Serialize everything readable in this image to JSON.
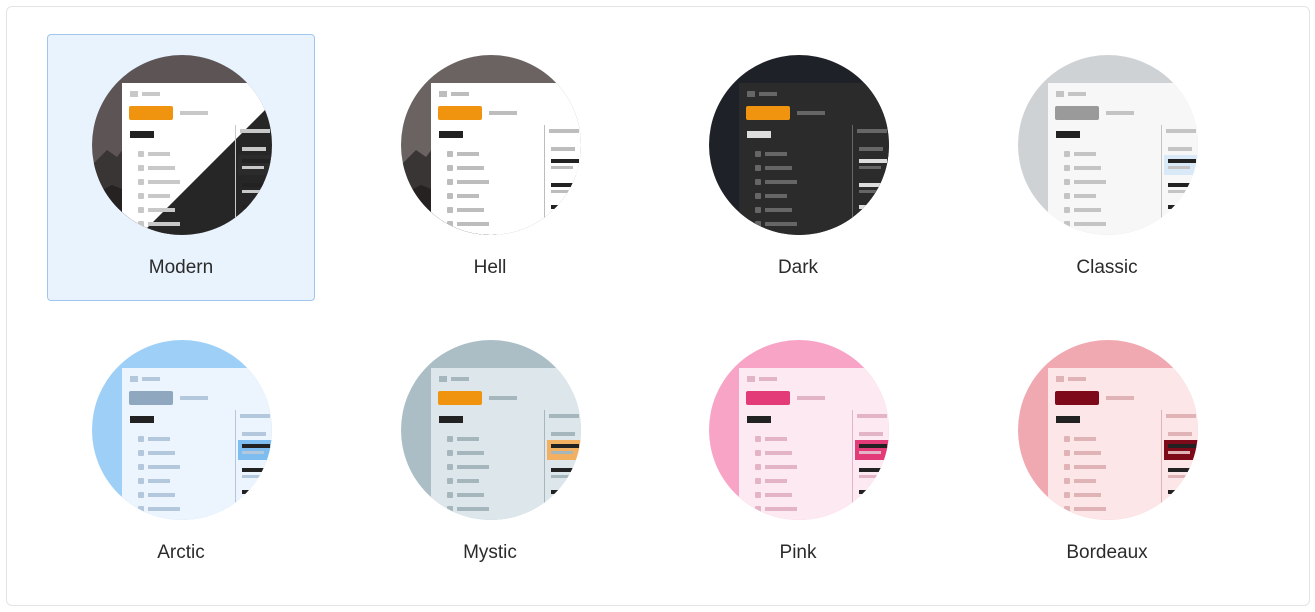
{
  "selected": "Modern",
  "themes": [
    {
      "label": "Modern",
      "bg": "#5d5555",
      "pane": "#ffffff",
      "text": "#222222",
      "muted": "#c8c8c8",
      "accent": "#f0930e",
      "sel": "#2b2b2b",
      "style": "modern"
    },
    {
      "label": "Hell",
      "bg": "#6a6361",
      "pane": "#ffffff",
      "text": "#222222",
      "muted": "#bdbdbd",
      "accent": "#f0930e",
      "sel": "#ffffff",
      "style": "photo"
    },
    {
      "label": "Dark",
      "bg": "#1e2127",
      "pane": "#2b2b2b",
      "text": "#dddddd",
      "muted": "#666666",
      "accent": "#f0930e",
      "sel": "#2b2b2b",
      "style": "dark"
    },
    {
      "label": "Classic",
      "bg": "#cfd2d5",
      "pane": "#f7f7f7",
      "text": "#222222",
      "muted": "#c4c4c4",
      "accent": "#9a9a9a",
      "sel": "#d9e9f7",
      "style": "plain"
    },
    {
      "label": "Arctic",
      "bg": "#9dcff7",
      "pane": "#ecf4fd",
      "text": "#222222",
      "muted": "#b3c8dc",
      "accent": "#8fa8c0",
      "sel": "#7dbdf0",
      "style": "plain"
    },
    {
      "label": "Mystic",
      "bg": "#abbec6",
      "pane": "#dde7eb",
      "text": "#222222",
      "muted": "#a6b6bd",
      "accent": "#f0930e",
      "sel": "#f4b061",
      "style": "plain"
    },
    {
      "label": "Pink",
      "bg": "#f7a4c6",
      "pane": "#fde9f1",
      "text": "#222222",
      "muted": "#e3b3c6",
      "accent": "#e33a78",
      "sel": "#e33a78",
      "style": "plain"
    },
    {
      "label": "Bordeaux",
      "bg": "#f0a9b0",
      "pane": "#fde6e8",
      "text": "#222222",
      "muted": "#e0b3b7",
      "accent": "#7e0a19",
      "sel": "#7e0a19",
      "style": "plain"
    }
  ]
}
